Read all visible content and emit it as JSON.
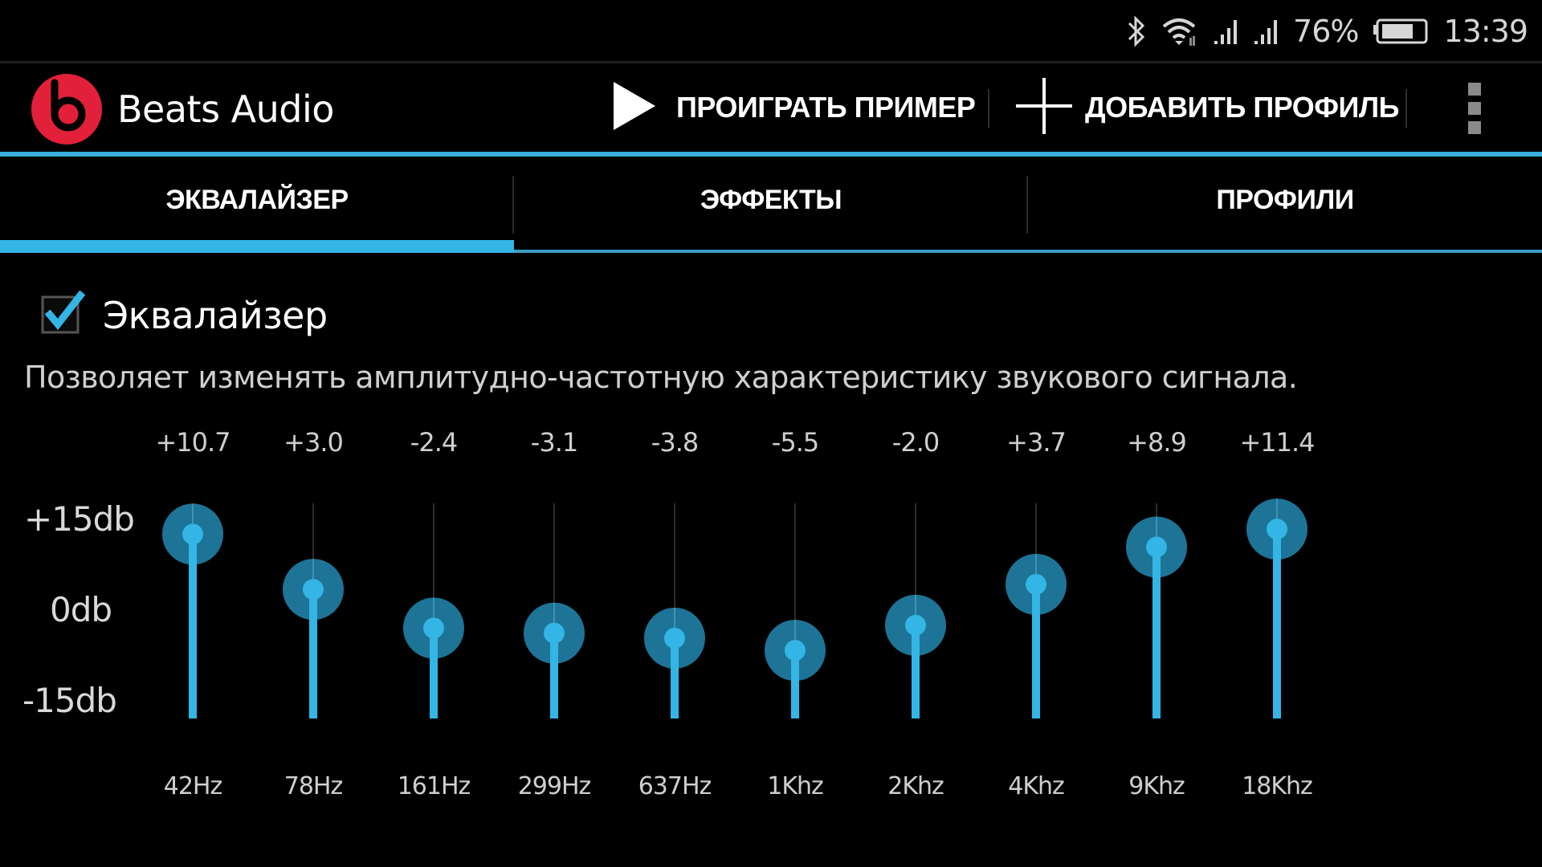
{
  "status_bar": {
    "icons": [
      "bluetooth-icon",
      "wifi-icon",
      "signal-icon-sim1",
      "signal-icon-sim2",
      "battery-icon"
    ],
    "battery_percent": "76%",
    "battery_level": 0.76,
    "time": "13:39"
  },
  "action_bar": {
    "app_title": "Beats Audio",
    "logo": "beats-logo",
    "play_label": "ПРОИГРАТЬ ПРИМЕР",
    "add_profile_label": "ДОБАВИТЬ ПРОФИЛЬ",
    "overflow_icon": "overflow-menu-icon"
  },
  "colors": {
    "accent": "#33b5e5",
    "knob_halo": "#1f7a9e",
    "logo_red": "#e2203a",
    "background": "#000000"
  },
  "tabs": [
    {
      "label": "ЭКВАЛАЙЗЕР",
      "active": true
    },
    {
      "label": "ЭФФЕКТЫ",
      "active": false
    },
    {
      "label": "ПРОФИЛИ",
      "active": false
    }
  ],
  "equalizer": {
    "enabled": true,
    "checkbox_label": "Эквалайзер",
    "description": "Позволяет изменять амплитудно-частотную характеристику звукового сигнала.",
    "axis_labels": {
      "top": "+15db",
      "middle": "0db",
      "bottom": "-15db"
    }
  },
  "chart_data": {
    "type": "bar",
    "title": "",
    "xlabel": "",
    "ylabel": "dB",
    "ylim": [
      -15,
      15
    ],
    "yticks": [
      "+15db",
      "0db",
      "-15db"
    ],
    "categories": [
      "42Hz",
      "78Hz",
      "161Hz",
      "299Hz",
      "637Hz",
      "1Khz",
      "2Khz",
      "4Khz",
      "9Khz",
      "18Khz"
    ],
    "value_labels": [
      "+10.7",
      "+3.0",
      "-2.4",
      "-3.1",
      "-3.8",
      "-5.5",
      "-2.0",
      "+3.7",
      "+8.9",
      "+11.4"
    ],
    "values": [
      10.7,
      3.0,
      -2.4,
      -3.1,
      -3.8,
      -5.5,
      -2.0,
      3.7,
      8.9,
      11.4
    ]
  }
}
